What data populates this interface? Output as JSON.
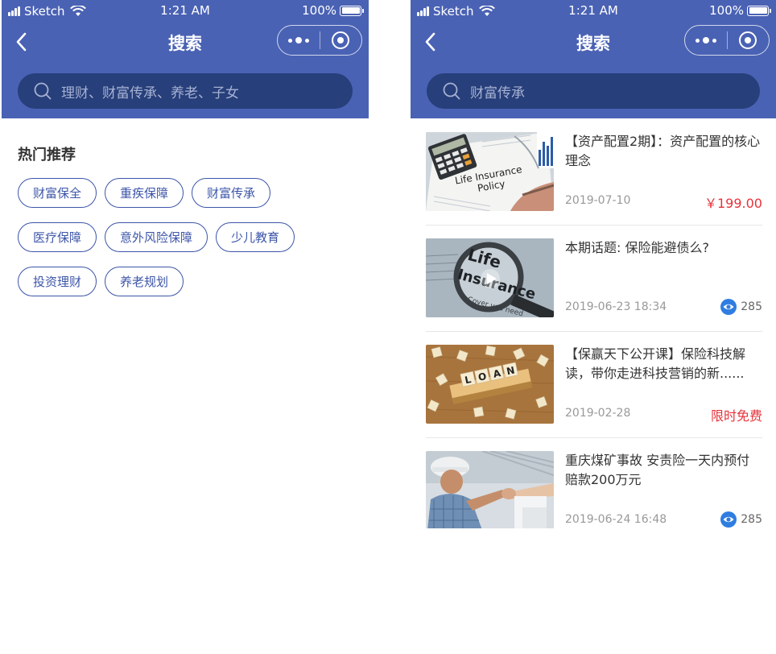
{
  "status_bar": {
    "carrier": "Sketch",
    "time": "1:21 AM",
    "battery": "100%"
  },
  "left_screen": {
    "title": "搜索",
    "search_placeholder": "理财、财富传承、养老、子女",
    "section_title": "热门推荐",
    "tags": [
      "财富保全",
      "重疾保障",
      "财富传承",
      "医疗保障",
      "意外风险保障",
      "少儿教育",
      "投资理财",
      "养老规划"
    ]
  },
  "right_screen": {
    "title": "搜索",
    "search_query": "财富传承",
    "results": [
      {
        "title": "【资产配置2期】：资产配置的核心理念",
        "date": "2019-07-10",
        "price": "￥199.00",
        "thumbnail": "life-insurance-policy-photo"
      },
      {
        "title": "本期话题: 保险能避债么?",
        "date": "2019-06-23 18:34",
        "views": "285",
        "thumbnail": "life-insurance-magnifier-video"
      },
      {
        "title": "【保赢天下公开课】保险科技解读，带你走进科技营销的新......",
        "date": "2019-02-28",
        "tag": "限时免费",
        "thumbnail": "loan-scrabble-tiles-photo"
      },
      {
        "title": "重庆煤矿事故 安责险一天内预付赔款200万元",
        "date": "2019-06-24 16:48",
        "views": "285",
        "thumbnail": "worker-handshake-photo"
      }
    ]
  },
  "colors": {
    "header_bg": "#4a62b4",
    "search_bg": "#273f7a",
    "tag_border": "#3c55a8",
    "price_red": "#e5333a",
    "eye_blue": "#2f7de1"
  }
}
